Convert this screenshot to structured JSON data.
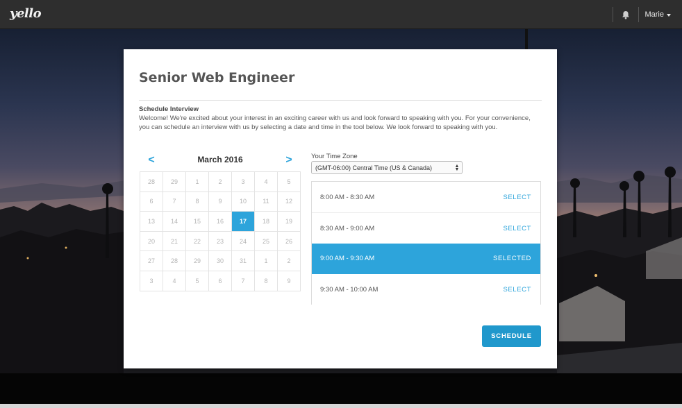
{
  "nav": {
    "logo": "yello",
    "user_name": "Marie",
    "bell_icon": "bell-icon"
  },
  "modal": {
    "job_title": "Senior Web Engineer",
    "section_title": "Schedule Interview",
    "intro": "Welcome! We're excited about your interest in an exciting career with us and look forward to speaking with you. For your convenience, you can schedule an interview with us by selecting a date and time in the tool below. We look forward to speaking with you."
  },
  "calendar": {
    "month_label": "March  2016",
    "prev_label": "<",
    "next_label": ">",
    "selected_day": "17",
    "days": [
      "28",
      "29",
      "1",
      "2",
      "3",
      "4",
      "5",
      "6",
      "7",
      "8",
      "9",
      "10",
      "11",
      "12",
      "13",
      "14",
      "15",
      "16",
      "17",
      "18",
      "19",
      "20",
      "21",
      "22",
      "23",
      "24",
      "25",
      "26",
      "27",
      "28",
      "29",
      "30",
      "31",
      "1",
      "2",
      "3",
      "4",
      "5",
      "6",
      "7",
      "8",
      "9"
    ]
  },
  "timezone": {
    "label": "Your Time Zone",
    "value": "(GMT-06:00) Central Time (US & Canada)"
  },
  "slots": [
    {
      "time": "8:00 AM - 8:30 AM",
      "action": "SELECT"
    },
    {
      "time": "8:30 AM - 9:00 AM",
      "action": "SELECT"
    },
    {
      "time": "9:00 AM - 9:30 AM",
      "action": "SELECTED"
    },
    {
      "time": "9:30 AM - 10:00 AM",
      "action": "SELECT"
    }
  ],
  "schedule_button": "SCHEDULE",
  "colors": {
    "accent": "#2da4db",
    "button": "#2098cc",
    "topbar": "#2e2e2e"
  }
}
